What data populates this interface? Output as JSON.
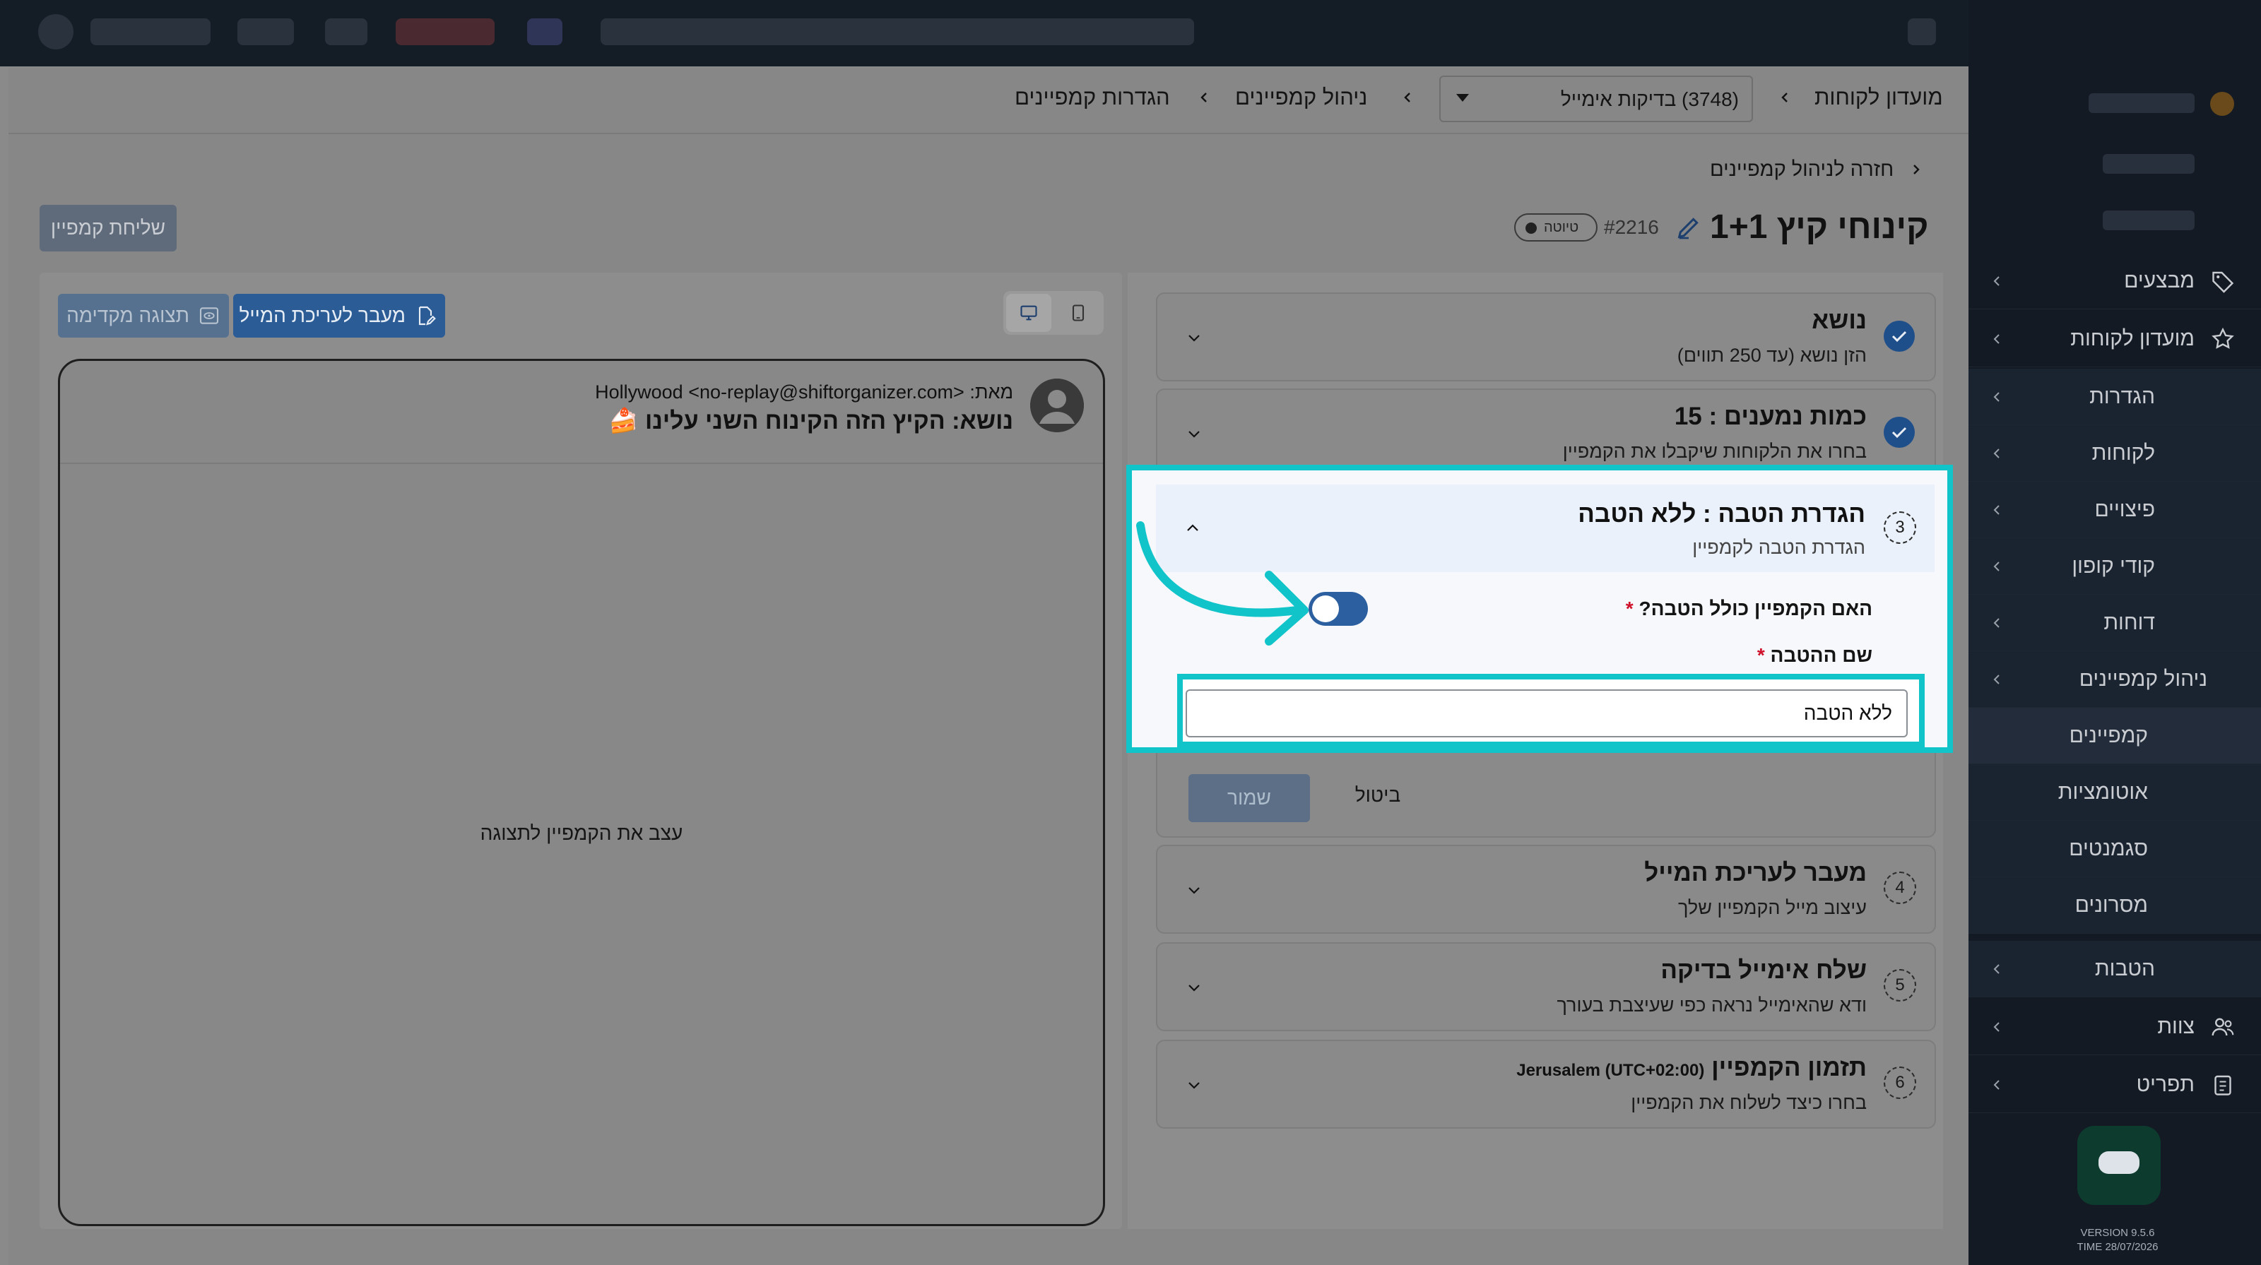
{
  "breadcrumb": {
    "club": "מועדון לקוחות",
    "account": "(3748) בדיקות אימייל",
    "campaigns_mgmt": "ניהול קמפיינים",
    "campaign_settings": "הגדרות קמפיינים"
  },
  "header": {
    "back_link": "חזרה לניהול קמפיינים",
    "title": "קינוחי קיץ 1+1",
    "campaign_id": "#2216",
    "status_badge": "טיוטה",
    "send_button": "שליחת קמפיין"
  },
  "preview": {
    "edit_email_button": "מעבר לעריכת המייל",
    "preview_button": "תצוגה מקדימה",
    "from_label": "מאת:",
    "from_value": "Hollywood <no-replay@shiftorganizer.com>",
    "subject": "נושא: הקיץ הזה הקינוח השני עלינו 🍰",
    "empty_message": "עצב את הקמפיין לתצוגה"
  },
  "steps": {
    "subject": {
      "title": "נושא",
      "subtitle": "הזן נושא (עד 250 תווים)"
    },
    "recipients": {
      "title": "כמות נמענים : 15",
      "subtitle": "בחרו את הלקוחות שיקבלו את הקמפיין"
    },
    "gift": {
      "number": "3",
      "title": "הגדרת הטבה : ללא הטבה",
      "subtitle": "הגדרת הטבה לקמפיין",
      "question": "האם הקמפיין כולל הטבה?",
      "name_label": "שם ההטבה",
      "name_value": "ללא הטבה",
      "required_mark": "*",
      "save_button": "שמור",
      "cancel_button": "ביטול"
    },
    "edit_email": {
      "number": "4",
      "title": "מעבר לעריכת המייל",
      "subtitle": "עיצוב מייל הקמפיין שלך"
    },
    "test_email": {
      "number": "5",
      "title": "שלח אימייל בדיקה",
      "subtitle": "ודא שהאימייל נראה כפי שעיצבת בעורך"
    },
    "schedule": {
      "number": "6",
      "title": "תזמון הקמפיין",
      "timezone": "Jerusalem (UTC+02:00)",
      "subtitle": "בחרו כיצד לשלוח את הקמפיין"
    }
  },
  "sidebar": {
    "items": [
      {
        "label": "מבצעים",
        "icon": "tag-icon"
      },
      {
        "label": "מועדון לקוחות",
        "icon": "star-icon"
      },
      {
        "label": "הגדרות"
      },
      {
        "label": "לקוחות"
      },
      {
        "label": "פיצויים"
      },
      {
        "label": "קודי קופון"
      },
      {
        "label": "דוחות"
      },
      {
        "label": "ניהול קמפיינים"
      },
      {
        "label": "קמפיינים"
      },
      {
        "label": "אוטומציות"
      },
      {
        "label": "סגמנטים"
      },
      {
        "label": "מסרונים"
      },
      {
        "label": "הטבות"
      },
      {
        "label": "צוות",
        "icon": "users-icon"
      },
      {
        "label": "תפריט",
        "icon": "menu-icon"
      }
    ],
    "version": "VERSION 9.5.6",
    "time": "TIME 28/07/2026"
  },
  "colors": {
    "accent_highlight": "#10c4c9",
    "primary": "#2b5fa0",
    "sidebar_bg": "#131a24"
  }
}
